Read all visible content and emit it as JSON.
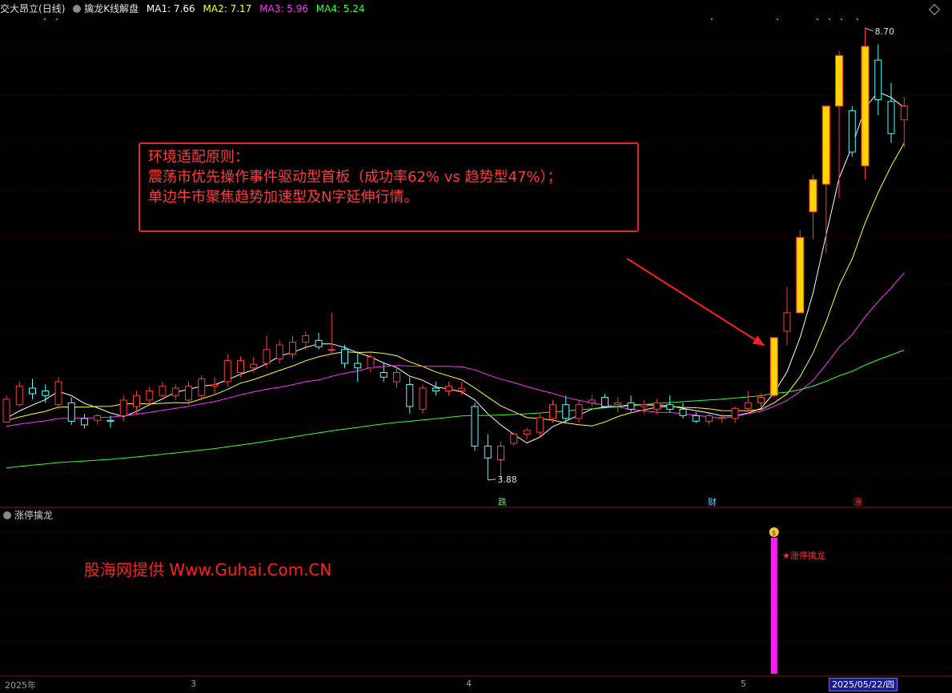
{
  "header": {
    "stock_name": "交大昂立",
    "period": "(日线)",
    "indicator": "擒龙K线解盘",
    "ma": [
      {
        "label": "MA1: 7.66",
        "color": "#ffffff"
      },
      {
        "label": "MA2: 7.17",
        "color": "#ffff33"
      },
      {
        "label": "MA3: 5.96",
        "color": "#ff33ff"
      },
      {
        "label": "MA4: 5.24",
        "color": "#33ff33"
      }
    ]
  },
  "callout": {
    "line1": "环境适配原则：",
    "line2": "震荡市优先操作事件驱动型首板（成功率62% vs 趋势型47%）；",
    "line3": "单边牛市聚焦趋势加速型及N字延伸行情。"
  },
  "sub_panel": {
    "title": "涨停擒龙",
    "signal_label": "★涨停擒龙",
    "watermark": "股海网提供 Www.Guhai.Com.CN"
  },
  "markers": [
    {
      "text": "跌",
      "color": "#33ff33"
    },
    {
      "text": "财",
      "color": "#66ccff"
    },
    {
      "text": "涨",
      "color": "#ff3333"
    }
  ],
  "x_axis": {
    "ticks": [
      "2025年",
      "3",
      "4",
      "5"
    ],
    "current_date": "2025/05/22/四"
  },
  "chart_data": {
    "type": "candlestick",
    "price_annotations": {
      "high": "8.70",
      "low": "3.88"
    },
    "ylim": [
      3.6,
      9.0
    ],
    "candles": [
      [
        4.51,
        4.8,
        4.5,
        4.76
      ],
      [
        4.7,
        4.95,
        4.68,
        4.9
      ],
      [
        4.88,
        4.98,
        4.76,
        4.82
      ],
      [
        4.85,
        4.92,
        4.72,
        4.8
      ],
      [
        4.7,
        5.0,
        4.65,
        4.95
      ],
      [
        4.72,
        4.78,
        4.48,
        4.52
      ],
      [
        4.55,
        4.6,
        4.44,
        4.48
      ],
      [
        4.53,
        4.6,
        4.48,
        4.58
      ],
      [
        4.53,
        4.58,
        4.45,
        4.52
      ],
      [
        4.58,
        4.8,
        4.52,
        4.75
      ],
      [
        4.68,
        4.85,
        4.6,
        4.8
      ],
      [
        4.75,
        4.9,
        4.7,
        4.85
      ],
      [
        4.8,
        4.95,
        4.78,
        4.9
      ],
      [
        4.8,
        4.92,
        4.75,
        4.88
      ],
      [
        4.75,
        4.95,
        4.7,
        4.9
      ],
      [
        4.8,
        5.02,
        4.75,
        4.98
      ],
      [
        4.9,
        5.0,
        4.82,
        4.92
      ],
      [
        4.95,
        5.25,
        4.9,
        5.18
      ],
      [
        5.05,
        5.22,
        5.0,
        5.18
      ],
      [
        5.1,
        5.22,
        5.05,
        5.14
      ],
      [
        5.15,
        5.45,
        5.1,
        5.3
      ],
      [
        5.2,
        5.4,
        5.15,
        5.35
      ],
      [
        5.25,
        5.45,
        5.2,
        5.38
      ],
      [
        5.38,
        5.5,
        5.3,
        5.45
      ],
      [
        5.4,
        5.48,
        5.3,
        5.33
      ],
      [
        5.3,
        5.7,
        5.25,
        5.3
      ],
      [
        5.3,
        5.35,
        5.1,
        5.15
      ],
      [
        5.15,
        5.28,
        4.95,
        5.1
      ],
      [
        5.1,
        5.25,
        5.05,
        5.22
      ],
      [
        5.05,
        5.15,
        4.95,
        5.0
      ],
      [
        4.95,
        5.1,
        4.88,
        5.05
      ],
      [
        4.92,
        5.0,
        4.6,
        4.68
      ],
      [
        4.65,
        4.92,
        4.6,
        4.88
      ],
      [
        4.88,
        4.95,
        4.8,
        4.85
      ],
      [
        4.85,
        4.95,
        4.8,
        4.9
      ],
      [
        4.85,
        4.95,
        4.8,
        4.88
      ],
      [
        4.68,
        4.72,
        4.2,
        4.25
      ],
      [
        4.25,
        4.38,
        3.88,
        4.12
      ],
      [
        4.1,
        4.3,
        3.88,
        4.25
      ],
      [
        4.28,
        4.4,
        4.25,
        4.38
      ],
      [
        4.38,
        4.45,
        4.32,
        4.42
      ],
      [
        4.4,
        4.6,
        4.35,
        4.56
      ],
      [
        4.55,
        4.75,
        4.5,
        4.7
      ],
      [
        4.7,
        4.8,
        4.5,
        4.55
      ],
      [
        4.55,
        4.75,
        4.5,
        4.7
      ],
      [
        4.72,
        4.8,
        4.68,
        4.75
      ],
      [
        4.78,
        4.82,
        4.66,
        4.68
      ],
      [
        4.7,
        4.78,
        4.62,
        4.72
      ],
      [
        4.72,
        4.8,
        4.62,
        4.65
      ],
      [
        4.68,
        4.75,
        4.6,
        4.7
      ],
      [
        4.65,
        4.76,
        4.6,
        4.72
      ],
      [
        4.7,
        4.8,
        4.62,
        4.65
      ],
      [
        4.65,
        4.72,
        4.55,
        4.58
      ],
      [
        4.58,
        4.62,
        4.5,
        4.52
      ],
      [
        4.52,
        4.6,
        4.48,
        4.58
      ],
      [
        4.55,
        4.6,
        4.5,
        4.56
      ],
      [
        4.55,
        4.68,
        4.5,
        4.66
      ],
      [
        4.66,
        4.85,
        4.6,
        4.72
      ],
      [
        4.72,
        4.82,
        4.68,
        4.78
      ],
      [
        4.8,
        5.43,
        4.78,
        5.43
      ],
      [
        5.5,
        5.98,
        5.35,
        5.7
      ],
      [
        5.7,
        6.6,
        5.7,
        6.52
      ],
      [
        6.8,
        7.2,
        6.5,
        7.15
      ],
      [
        7.1,
        7.95,
        6.35,
        7.95
      ],
      [
        7.95,
        8.55,
        6.95,
        8.5
      ],
      [
        7.9,
        7.95,
        7.4,
        7.45
      ],
      [
        7.3,
        8.8,
        7.15,
        8.6
      ],
      [
        8.45,
        8.62,
        7.85,
        8.02
      ],
      [
        8.0,
        8.2,
        7.55,
        7.65
      ],
      [
        7.8,
        8.05,
        7.5,
        7.95
      ]
    ]
  }
}
